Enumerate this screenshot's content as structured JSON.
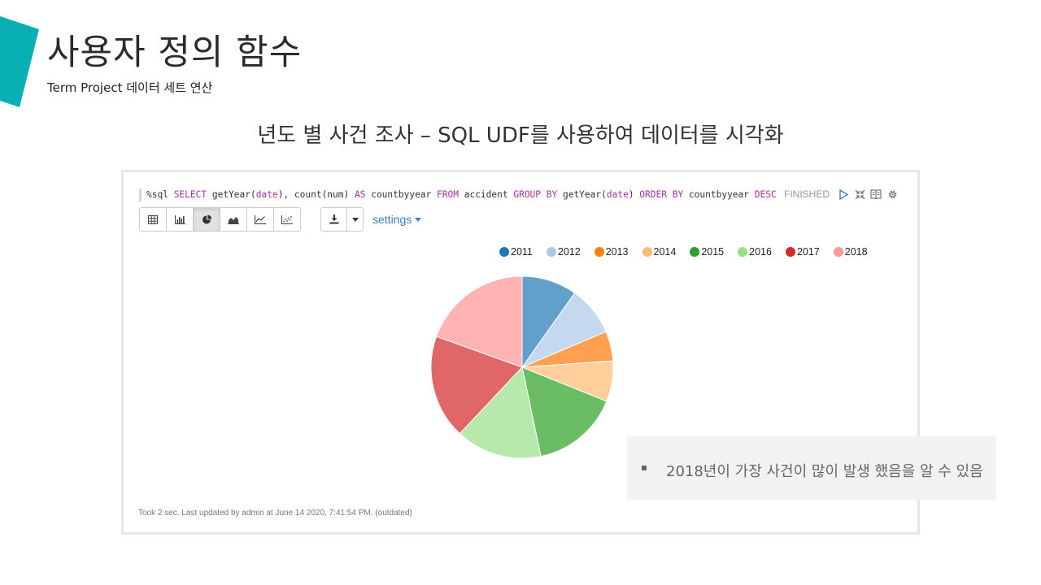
{
  "slide": {
    "title": "사용자 정의 함수",
    "subtitle": "Term Project 데이터 세트 연산",
    "heading": "년도 별 사건 조사 – SQL UDF를 사용하여 데이터를 시각화",
    "accent_color": "#08b0b5"
  },
  "notebook": {
    "code_tokens": [
      {
        "text": "%sql ",
        "kw": false
      },
      {
        "text": "SELECT",
        "kw": true
      },
      {
        "text": " getYear(",
        "kw": false
      },
      {
        "text": "date",
        "kw": true
      },
      {
        "text": "), count(num) ",
        "kw": false
      },
      {
        "text": "AS",
        "kw": true
      },
      {
        "text": " countbyyear ",
        "kw": false
      },
      {
        "text": "FROM",
        "kw": true
      },
      {
        "text": " accident ",
        "kw": false
      },
      {
        "text": "GROUP BY",
        "kw": true
      },
      {
        "text": " getYear(",
        "kw": false
      },
      {
        "text": "date",
        "kw": true
      },
      {
        "text": ") ",
        "kw": false
      },
      {
        "text": "ORDER BY",
        "kw": true
      },
      {
        "text": " countbyyear ",
        "kw": false
      },
      {
        "text": "DESC",
        "kw": true
      }
    ],
    "status": "FINISHED",
    "status_icons": [
      "play-icon",
      "collapse-icon",
      "book-icon",
      "gear-icon"
    ],
    "toolbar_buttons": [
      {
        "name": "table-view-button",
        "icon": "table-icon",
        "active": false
      },
      {
        "name": "bar-chart-button",
        "icon": "bar-chart-icon",
        "active": false
      },
      {
        "name": "pie-chart-button",
        "icon": "pie-chart-icon",
        "active": true
      },
      {
        "name": "area-chart-button",
        "icon": "area-chart-icon",
        "active": false
      },
      {
        "name": "line-chart-button",
        "icon": "line-chart-icon",
        "active": false
      },
      {
        "name": "scatter-chart-button",
        "icon": "scatter-chart-icon",
        "active": false
      }
    ],
    "settings_label": "settings",
    "footer": "Took 2 sec. Last updated by admin at June 14 2020, 7:41:54 PM. (outdated)"
  },
  "chart_data": {
    "type": "pie",
    "categories": [
      "2011",
      "2012",
      "2013",
      "2014",
      "2015",
      "2016",
      "2017",
      "2018"
    ],
    "values": [
      9.8,
      8.8,
      5.3,
      7.2,
      15.6,
      15.3,
      18.5,
      19.5
    ],
    "legend_colors": [
      "#1f77b4",
      "#aec7e8",
      "#ff7f0e",
      "#ffbb78",
      "#2ca02c",
      "#98df8a",
      "#d62728",
      "#ff9896"
    ],
    "slice_colors": [
      "#62a0cb",
      "#c4d8f0",
      "#fea04f",
      "#ffcf9b",
      "#6abd65",
      "#b6e9ab",
      "#e06668",
      "#ffb4b3"
    ],
    "legend_position": "top"
  },
  "callout": {
    "text": "2018년이 가장 사건이 많이 발생 했음을 알 수 있음"
  }
}
